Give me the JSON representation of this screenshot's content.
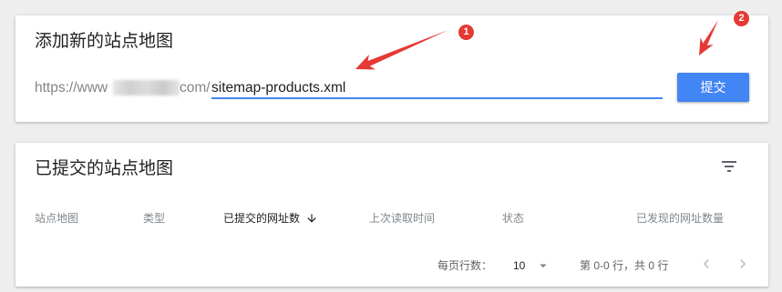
{
  "add_sitemap": {
    "title": "添加新的站点地图",
    "url_prefix": "https://www",
    "url_suffix": "com/",
    "input_value": "sitemap-products.xml",
    "submit_label": "提交"
  },
  "submitted_sitemaps": {
    "title": "已提交的站点地图",
    "columns": [
      {
        "label": "站点地图"
      },
      {
        "label": "类型"
      },
      {
        "label": "已提交的网址数",
        "sort_icon": "arrow-downward-icon"
      },
      {
        "label": "上次读取时间"
      },
      {
        "label": "状态"
      },
      {
        "label": "已发现的网址数量"
      }
    ],
    "pagination": {
      "rows_per_page_label": "每页行数：",
      "rows_per_page_value": "10",
      "range_text": "第 0-0 行，共 0 行"
    }
  },
  "annotations": {
    "markers": [
      {
        "label": "1"
      },
      {
        "label": "2"
      }
    ]
  },
  "icons": {
    "filter": "filter-icon",
    "sort": "arrow-downward-icon",
    "dropdown": "arrow-drop-down-icon",
    "prev_page": "chevron-left-icon",
    "next_page": "chevron-right-icon"
  },
  "colors": {
    "accent": "#4285f4",
    "annotation": "#e53935",
    "page_background": "#eeeeee",
    "card_background": "#ffffff"
  }
}
